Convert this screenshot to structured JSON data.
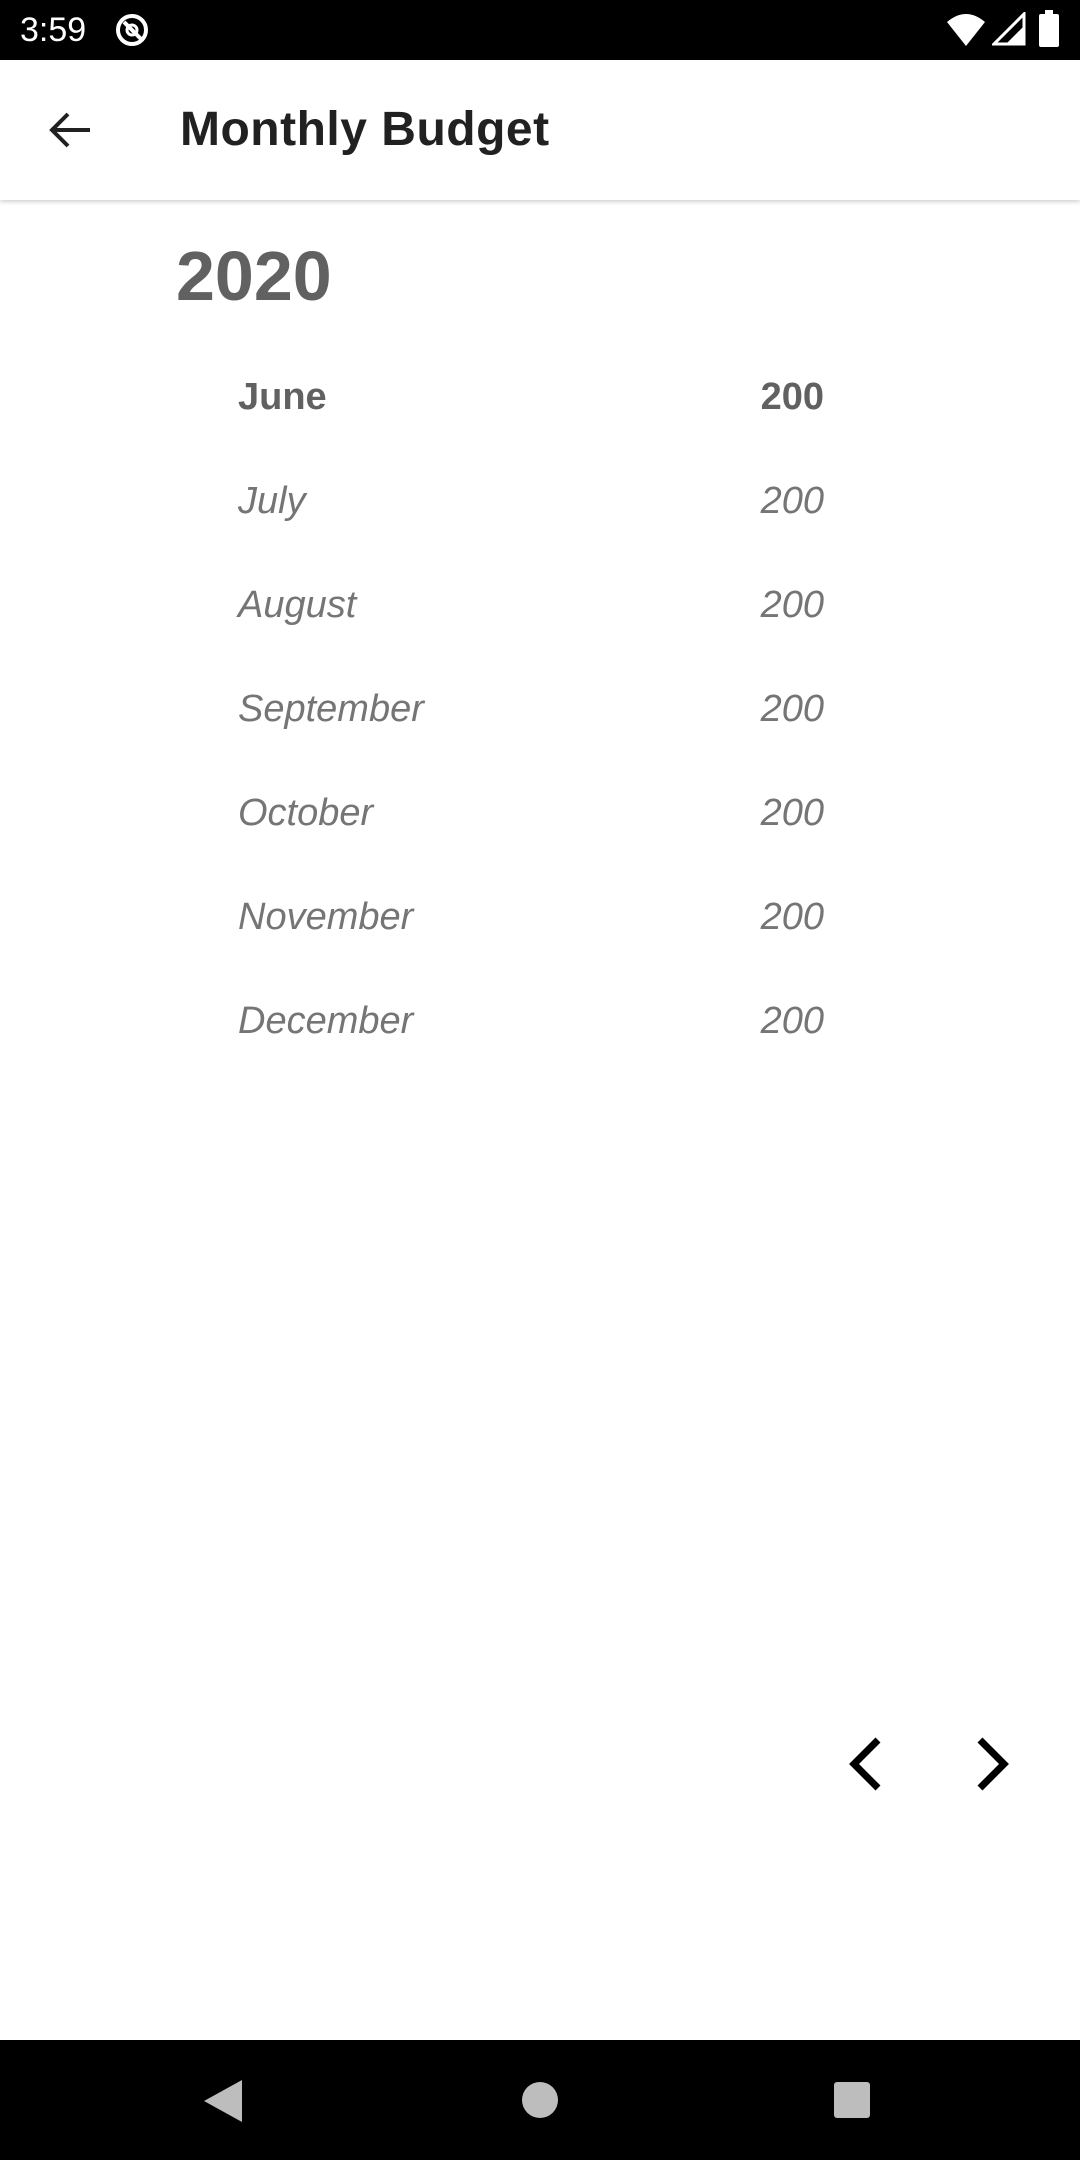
{
  "status_bar": {
    "time": "3:59",
    "icons": [
      "app-notification-icon",
      "wifi-icon",
      "cell-signal-icon",
      "battery-icon"
    ]
  },
  "app_bar": {
    "title": "Monthly Budget",
    "back_icon": "arrow-back-icon"
  },
  "budget": {
    "year": "2020",
    "months": [
      {
        "name": "June",
        "amount": "200",
        "current": true
      },
      {
        "name": "July",
        "amount": "200",
        "current": false
      },
      {
        "name": "August",
        "amount": "200",
        "current": false
      },
      {
        "name": "September",
        "amount": "200",
        "current": false
      },
      {
        "name": "October",
        "amount": "200",
        "current": false
      },
      {
        "name": "November",
        "amount": "200",
        "current": false
      },
      {
        "name": "December",
        "amount": "200",
        "current": false
      }
    ]
  },
  "pager": {
    "prev_icon": "chevron-left-icon",
    "next_icon": "chevron-right-icon"
  },
  "nav_bar": {
    "icons": [
      "nav-back-icon",
      "nav-home-icon",
      "nav-recents-icon"
    ]
  },
  "colors": {
    "title": "#212121",
    "year": "#616161",
    "current_month": "#616161",
    "other_month": "#757575",
    "system_bars": "#000000"
  }
}
